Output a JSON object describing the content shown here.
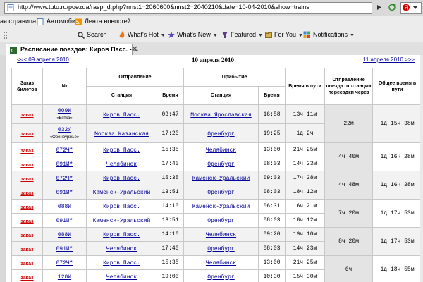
{
  "browser": {
    "address": "http://www.tutu.ru/poezda/rasp_d.php?nnst1=2060600&nnst2=2040210&date=10-04-2010&show=trains",
    "links": [
      {
        "label": "ая страница"
      },
      {
        "label": "Автомобили"
      },
      {
        "label": "Лента новостей"
      }
    ],
    "toolbar": [
      {
        "label": "Search"
      },
      {
        "label": "What's Hot"
      },
      {
        "label": "What's New"
      },
      {
        "label": "Featured"
      },
      {
        "label": "For You"
      },
      {
        "label": "Notifications"
      }
    ],
    "tab_title": "Расписание поездов: Киров Пасс. - ..."
  },
  "nav": {
    "prev": "<<< 09 апреля 2010",
    "current": "10 апреля 2010",
    "next": "11 апреля 2010 >>>"
  },
  "table": {
    "headers": {
      "order": "Заказ билетов",
      "number": "№",
      "departure": "Отправление",
      "arrival": "Прибытие",
      "station": "Станция",
      "time": "Время",
      "travel": "Время в пути",
      "transfer": "Отправление поезда от станции пересадки через",
      "total": "Общее время в пути"
    },
    "order_label": "заказ",
    "groups": [
      {
        "legs": [
          {
            "train": "009И",
            "train_name": "«Вятка»",
            "from": "Киров Пасс.",
            "dep": "03:47",
            "to": "Москва Ярославская",
            "arr": "16:58",
            "travel": "13ч 11м"
          },
          {
            "train": "032У",
            "train_name": "«Оренбуржье»",
            "from": "Москва Казанская",
            "dep": "17:20",
            "to": "Оренбург",
            "arr": "19:25",
            "travel": "1д 2ч"
          }
        ],
        "transfer": "22м",
        "total": "1д 15ч 38м"
      },
      {
        "legs": [
          {
            "train": "072Ч*",
            "train_name": "",
            "from": "Киров Пасс.",
            "dep": "15:35",
            "to": "Челябинск",
            "arr": "13:00",
            "travel": "21ч 25м"
          },
          {
            "train": "091И*",
            "train_name": "",
            "from": "Челябинск",
            "dep": "17:40",
            "to": "Оренбург",
            "arr": "08:03",
            "travel": "14ч 23м"
          }
        ],
        "transfer": "4ч 40м",
        "total": "1д 16ч 28м"
      },
      {
        "legs": [
          {
            "train": "072Ч*",
            "train_name": "",
            "from": "Киров Пасс.",
            "dep": "15:35",
            "to": "Каменск-Уральский",
            "arr": "09:03",
            "travel": "17ч 28м"
          },
          {
            "train": "091И*",
            "train_name": "",
            "from": "Каменск-Уральский",
            "dep": "13:51",
            "to": "Оренбург",
            "arr": "08:03",
            "travel": "18ч 12м"
          }
        ],
        "transfer": "4ч 48м",
        "total": "1д 16ч 28м"
      },
      {
        "legs": [
          {
            "train": "088И",
            "train_name": "",
            "from": "Киров Пасс.",
            "dep": "14:10",
            "to": "Каменск-Уральский",
            "arr": "06:31",
            "travel": "16ч 21м"
          },
          {
            "train": "091И*",
            "train_name": "",
            "from": "Каменск-Уральский",
            "dep": "13:51",
            "to": "Оренбург",
            "arr": "08:03",
            "travel": "18ч 12м"
          }
        ],
        "transfer": "7ч 20м",
        "total": "1д 17ч 53м"
      },
      {
        "legs": [
          {
            "train": "088И",
            "train_name": "",
            "from": "Киров Пасс.",
            "dep": "14:10",
            "to": "Челябинск",
            "arr": "09:20",
            "travel": "19ч 10м"
          },
          {
            "train": "091И*",
            "train_name": "",
            "from": "Челябинск",
            "dep": "17:40",
            "to": "Оренбург",
            "arr": "08:03",
            "travel": "14ч 23м"
          }
        ],
        "transfer": "8ч 20м",
        "total": "1д 17ч 53м"
      },
      {
        "legs": [
          {
            "train": "072Ч*",
            "train_name": "",
            "from": "Киров Пасс.",
            "dep": "15:35",
            "to": "Челябинск",
            "arr": "13:00",
            "travel": "21ч 25м"
          },
          {
            "train": "120И",
            "train_name": "",
            "from": "Челябинск",
            "dep": "19:00",
            "to": "Оренбург",
            "arr": "10:30",
            "travel": "15ч 30м"
          }
        ],
        "transfer": "6ч",
        "total": "1д 18ч 55м"
      }
    ]
  },
  "colors": {
    "link": "#000099",
    "order": "#cc0000",
    "row_shade": "#f2f2f2"
  }
}
